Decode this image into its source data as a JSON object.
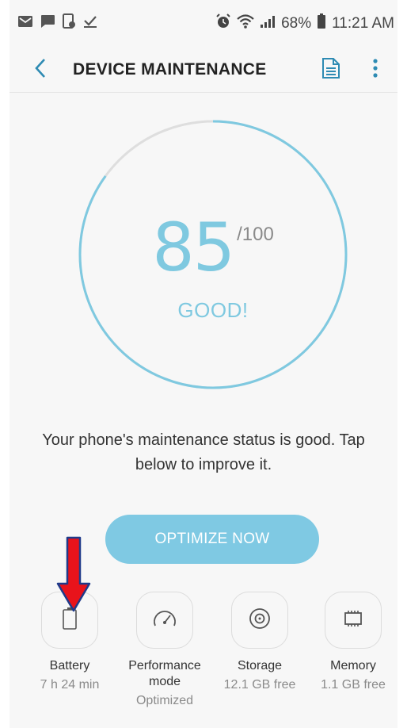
{
  "status_bar": {
    "left_icons": [
      "mail-icon",
      "chat-icon",
      "screenshot-icon",
      "download-done-icon"
    ],
    "alarm_icon": "alarm-icon",
    "wifi_icon": "wifi-icon",
    "signal_icon": "signal-icon",
    "battery_percent": "68%",
    "time": "11:21 AM"
  },
  "app_bar": {
    "title": "DEVICE MAINTENANCE",
    "back_icon": "back-arrow-icon",
    "report_icon": "document-icon",
    "more_icon": "more-vert-icon"
  },
  "score": {
    "value": "85",
    "max": "/100",
    "label": "GOOD!",
    "fraction": 0.85
  },
  "message": "Your phone's maintenance status is good. Tap below to improve it.",
  "optimize_button": "OPTIMIZE NOW",
  "tiles": [
    {
      "label": "Battery",
      "value": "7 h 24 min",
      "icon": "battery-icon"
    },
    {
      "label": "Performance mode",
      "value": "Optimized",
      "icon": "speedometer-icon"
    },
    {
      "label": "Storage",
      "value": "12.1 GB free",
      "icon": "storage-disc-icon"
    },
    {
      "label": "Memory",
      "value": "1.1 GB free",
      "icon": "memory-chip-icon"
    }
  ],
  "colors": {
    "accent": "#7fc9e0",
    "button": "#7fc9e3",
    "arrow_red": "#e8131b",
    "arrow_outline": "#1f3a8a"
  }
}
